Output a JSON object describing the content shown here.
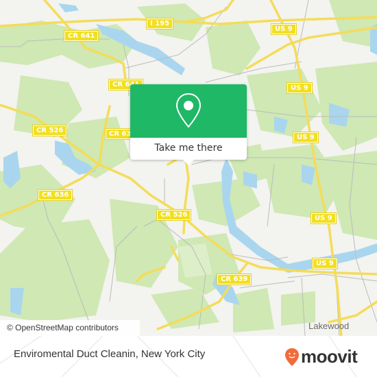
{
  "map": {
    "road_labels": [
      {
        "id": "i195",
        "text": "I 195"
      },
      {
        "id": "cr641a",
        "text": "CR 641"
      },
      {
        "id": "cr641b",
        "text": "CR 641"
      },
      {
        "id": "us9a",
        "text": "US 9"
      },
      {
        "id": "us9b",
        "text": "US 9"
      },
      {
        "id": "us9c",
        "text": "US 9"
      },
      {
        "id": "us9d",
        "text": "US 9"
      },
      {
        "id": "us9e",
        "text": "US 9"
      },
      {
        "id": "cr526a",
        "text": "CR 526"
      },
      {
        "id": "cr526b",
        "text": "CR 526"
      },
      {
        "id": "cr63x",
        "text": "CR 63"
      },
      {
        "id": "cr636",
        "text": "CR 636"
      },
      {
        "id": "cr639",
        "text": "CR 639"
      }
    ],
    "places": [
      {
        "text": "Lakewood"
      }
    ],
    "attribution": "© OpenStreetMap contributors",
    "colors": {
      "land": "#f3f3ef",
      "park": "#cfe8b4",
      "water": "#a9d6ee",
      "road": "#f4dc5a",
      "minor_road": "#bbbbbb"
    }
  },
  "popup": {
    "icon": "map-pin-icon",
    "button_label": "Take me there",
    "color": "#1fb866"
  },
  "footer": {
    "title": "Enviromental Duct Cleanin, New York City",
    "logo_text": "moovit",
    "logo_color": "#f26b3a"
  }
}
